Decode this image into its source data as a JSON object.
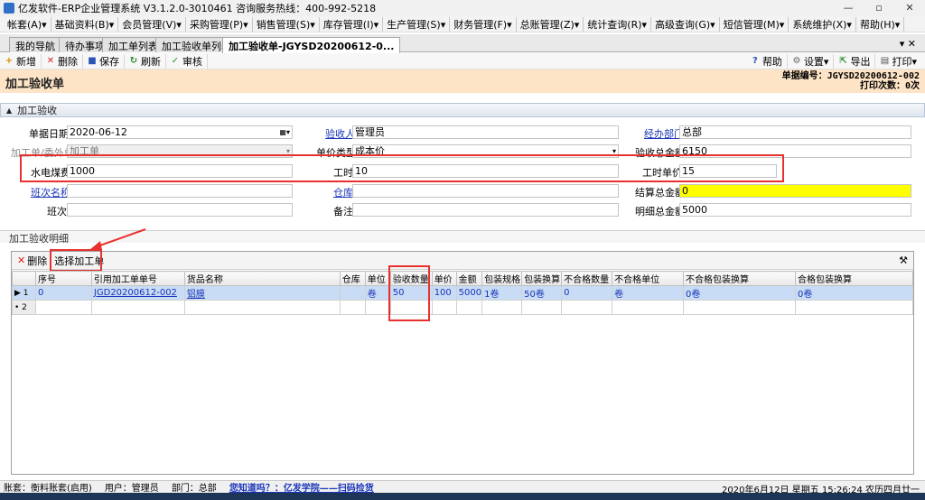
{
  "window": {
    "title": "亿发软件-ERP企业管理系统 V3.1.2.0-3010461 咨询服务热线：400-992-5218",
    "controls": [
      "—",
      "▫",
      "✕"
    ]
  },
  "menu": [
    "帐套(A)▾",
    "基础资料(B)▾",
    "会员管理(V)▾",
    "采购管理(P)▾",
    "销售管理(S)▾",
    "库存管理(I)▾",
    "生产管理(S)▾",
    "财务管理(F)▾",
    "总账管理(Z)▾",
    "统计查询(R)▾",
    "高级查询(G)▾",
    "短信管理(M)▾",
    "系统维护(X)▾",
    "帮助(H)▾"
  ],
  "tabs": [
    "我的导航",
    "待办事项",
    "加工单列表",
    "加工验收单列表",
    "加工验收单-JGYSD20200612-0..."
  ],
  "toolbar": {
    "new": "新增",
    "delete": "删除",
    "save": "保存",
    "refresh": "刷新",
    "approve": "审核",
    "help": "帮助",
    "settings": "设置▾",
    "export": "导出",
    "print": "打印▾"
  },
  "header": {
    "page_title": "加工验收单",
    "bill_no": "单据编号：JGYSD20200612-002",
    "print_count": "打印次数：0次"
  },
  "section_title": "加工验收",
  "form": {
    "bill_date_label": "单据日期",
    "bill_date": "2020-06-12",
    "receiver_label": "验收人",
    "receiver": "管理员",
    "dept_label": "经办部门",
    "dept": "总部",
    "source_label": "加工单/委外单",
    "source": "加工单",
    "price_type_label": "单价类型",
    "price_type": "成本价",
    "total_amount_label": "验收总金额",
    "total_amount": "6150",
    "utility_label": "水电煤费",
    "utility": "1000",
    "hours_label": "工时",
    "hours": "10",
    "hour_price_label": "工时单价",
    "hour_price": "15",
    "shift_name_label": "班次名称",
    "shift_name": "",
    "warehouse_label": "仓库",
    "warehouse": "",
    "settle_total_label": "结算总金额",
    "settle_total": "0",
    "shift_label": "班次",
    "shift": "",
    "remark_label": "备注",
    "remark": "",
    "detail_total_label": "明细总金额",
    "detail_total": "5000"
  },
  "detail": {
    "title": "加工验收明细",
    "delete": "删除",
    "select": "选择加工单",
    "columns": [
      "序号",
      "引用加工单单号",
      "货品名称",
      "仓库",
      "单位",
      "验收数量",
      "单价",
      "金额",
      "包装规格",
      "包装换算",
      "不合格数量",
      "不合格单位",
      "不合格包装换算",
      "合格包装换算"
    ],
    "rows": [
      [
        "0",
        "JGD20200612-002",
        "铝膜",
        "",
        "卷",
        "50",
        "100",
        "5000",
        "1卷",
        "50卷",
        "0",
        "卷",
        "0卷",
        "0卷"
      ]
    ],
    "row_headers": [
      "1",
      "2"
    ]
  },
  "status": {
    "account": "账套：衡料账套(启用)",
    "user": "用户：管理员",
    "department": "部门：总部",
    "promo": "您知道吗？：亿发学院——扫码捡货",
    "datetime": "2020年6月12日 星期五 15:26:24 农历四月廿一"
  }
}
